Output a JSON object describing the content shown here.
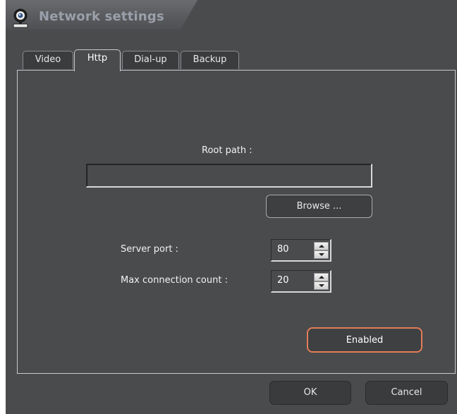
{
  "window": {
    "title": "Network settings",
    "icon": "webcam-icon"
  },
  "tabs": [
    {
      "label": "Video",
      "active": false
    },
    {
      "label": "Http",
      "active": true
    },
    {
      "label": "Dial-up",
      "active": false
    },
    {
      "label": "Backup",
      "active": false
    }
  ],
  "http": {
    "root_path_label": "Root path :",
    "root_path_value": "",
    "browse_label": "Browse ...",
    "server_port_label": "Server port :",
    "server_port_value": "80",
    "max_connection_label": "Max connection count :",
    "max_connection_value": "20",
    "enabled_label": "Enabled"
  },
  "footer": {
    "ok_label": "OK",
    "cancel_label": "Cancel"
  },
  "colors": {
    "background": "#4a4b4d",
    "accent_border": "#e37d58",
    "title_text": "#9aa0aa"
  }
}
